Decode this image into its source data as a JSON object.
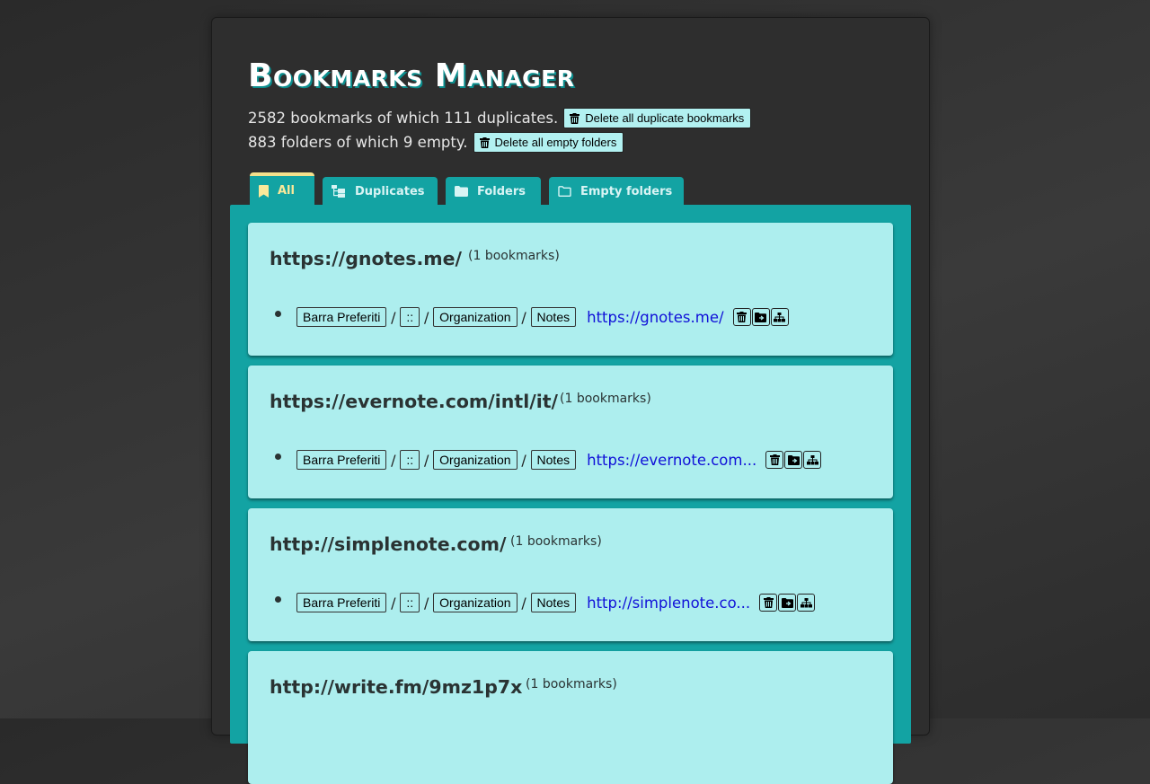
{
  "header": {
    "title": "Bookmarks Manager",
    "bookmarks_summary": "2582 bookmarks of which 111 duplicates.",
    "delete_duplicates_label": "Delete all duplicate bookmarks",
    "folders_summary": "883 folders of which 9 empty.",
    "delete_empty_label": "Delete all empty folders"
  },
  "tabs": [
    {
      "label": "All",
      "icon": "bookmark-icon",
      "active": true
    },
    {
      "label": "Duplicates",
      "icon": "folder-tree-icon",
      "active": false
    },
    {
      "label": "Folders",
      "icon": "folder-icon",
      "active": false
    },
    {
      "label": "Empty folders",
      "icon": "folder-outline-icon",
      "active": false
    }
  ],
  "cards": [
    {
      "title": "https://gnotes.me/",
      "count": "(1 bookmarks)",
      "path": [
        "Barra Preferiti",
        "::",
        "Organization",
        "Notes"
      ],
      "link": "https://gnotes.me/"
    },
    {
      "title": "https://evernote.com/intl/it/",
      "count": "(1 bookmarks)",
      "path": [
        "Barra Preferiti",
        "::",
        "Organization",
        "Notes"
      ],
      "link": "https://evernote.com..."
    },
    {
      "title": "http://simplenote.com/",
      "count": "(1 bookmarks)",
      "path": [
        "Barra Preferiti",
        "::",
        "Organization",
        "Notes"
      ],
      "link": "http://simplenote.co..."
    },
    {
      "title": "http://write.fm/9mz1p7x",
      "count": "(1 bookmarks)"
    }
  ],
  "path_separator": "/",
  "item_actions": [
    "trash-icon",
    "open-folder-icon",
    "sitemap-icon"
  ],
  "colors": {
    "tab_bg": "#13a3a3",
    "card_bg": "#adeeee",
    "active_tab_text": "#fbe99a",
    "link": "#1010d8",
    "button_bg": "#b2f1f1"
  }
}
